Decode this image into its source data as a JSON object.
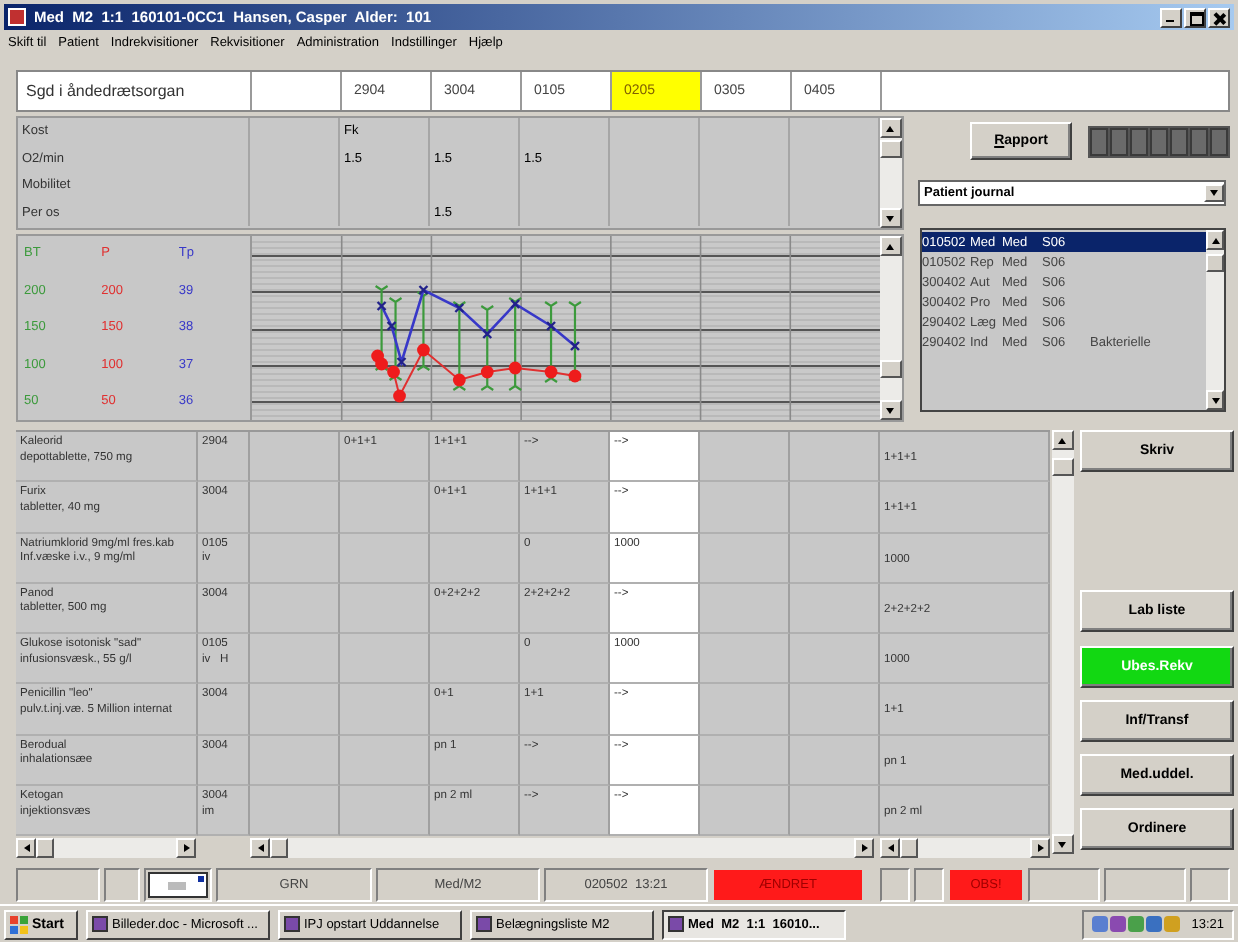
{
  "window": {
    "title": "Med  M2  1:1  160101-0CC1  Hansen, Casper  Alder:  101"
  },
  "menu": [
    "Skift til",
    "Patient",
    "Indrekvisitioner",
    "Rekvisitioner",
    "Administration",
    "Indstillinger",
    "Hjælp"
  ],
  "header": {
    "label": "Sgd i åndedrætsorgan",
    "dates": [
      {
        "label": "2904",
        "selected": false
      },
      {
        "label": "3004",
        "selected": false
      },
      {
        "label": "0105",
        "selected": false
      },
      {
        "label": "0205",
        "selected": true
      },
      {
        "label": "0305",
        "selected": false
      },
      {
        "label": "0405",
        "selected": false
      }
    ]
  },
  "observations": [
    {
      "label": "Kost",
      "values": [
        {
          "kind": "blank"
        },
        {
          "kind": "value",
          "text": "Fk"
        },
        {
          "kind": "blank"
        },
        {
          "kind": "blank"
        },
        {
          "kind": "blank"
        },
        {
          "kind": "blank"
        },
        {
          "kind": "blank"
        }
      ]
    },
    {
      "label": "O2/min",
      "values": [
        {
          "kind": "blank"
        },
        {
          "kind": "value",
          "text": "1.5"
        },
        {
          "kind": "value",
          "text": "1.5"
        },
        {
          "kind": "value",
          "text": "1.5"
        },
        {
          "kind": "blank"
        },
        {
          "kind": "blank"
        },
        {
          "kind": "blank"
        }
      ]
    },
    {
      "label": "Mobilitet",
      "values": [
        {
          "kind": "blank"
        },
        {
          "kind": "blank"
        },
        {
          "kind": "blank"
        },
        {
          "kind": "blank"
        },
        {
          "kind": "blank"
        },
        {
          "kind": "blank"
        },
        {
          "kind": "blank"
        }
      ]
    },
    {
      "label": "Per os",
      "values": [
        {
          "kind": "blank"
        },
        {
          "kind": "blank"
        },
        {
          "kind": "value",
          "text": "1.5"
        },
        {
          "kind": "blank"
        },
        {
          "kind": "blank"
        },
        {
          "kind": "blank"
        },
        {
          "kind": "blank"
        }
      ]
    }
  ],
  "vitals_scales": [
    {
      "name": "BT",
      "color": "#3c9a3c",
      "labels": [
        "200",
        "150",
        "100",
        "50"
      ]
    },
    {
      "name": "P",
      "color": "#e03030",
      "labels": [
        "200",
        "150",
        "100",
        "50"
      ]
    },
    {
      "name": "Tp",
      "color": "#3838c8",
      "labels": [
        "39",
        "38",
        "37",
        "36"
      ]
    }
  ],
  "report_button": "Rapport",
  "journal_dropdown": {
    "value": "Patient journal"
  },
  "journal_list": [
    {
      "cells": [
        "010502",
        "Med",
        "Med",
        "S06"
      ],
      "selected": true
    },
    {
      "cells": [
        "010502",
        "Rep",
        "Med",
        "S06"
      ],
      "selected": false
    },
    {
      "cells": [
        "300402",
        "Aut",
        "Med",
        "S06"
      ],
      "selected": false
    },
    {
      "cells": [
        "300402",
        "Pro",
        "Med",
        "S06"
      ],
      "selected": false
    },
    {
      "cells": [
        "290402",
        "Læg",
        "Med",
        "S06"
      ],
      "selected": false
    },
    {
      "cells": [
        "290402",
        "Ind",
        "Med",
        "S06",
        "Bakterielle"
      ],
      "selected": false
    }
  ],
  "medications": [
    {
      "name": "Kaleorid",
      "form": "depottablette, 750 mg",
      "date": "2904",
      "cells": [
        {
          "kind": "blank"
        },
        {
          "kind": "value",
          "text": "0+1+1"
        },
        {
          "kind": "value",
          "text": "1+1+1"
        },
        {
          "kind": "value",
          "text": "-->"
        },
        {
          "kind": "value",
          "text": "-->"
        },
        {
          "kind": "blank"
        },
        {
          "kind": "blank"
        }
      ],
      "current": "1+1+1"
    },
    {
      "name": "Furix",
      "form": "tabletter, 40 mg",
      "date": "3004",
      "cells": [
        {
          "kind": "blank"
        },
        {
          "kind": "blank"
        },
        {
          "kind": "value",
          "text": "0+1+1"
        },
        {
          "kind": "value",
          "text": "1+1+1"
        },
        {
          "kind": "value",
          "text": "-->"
        },
        {
          "kind": "blank"
        },
        {
          "kind": "blank"
        }
      ],
      "current": "1+1+1"
    },
    {
      "name": "Natriumklorid 9mg/ml fres.kab",
      "form": "Inf.væske i.v., 9 mg/ml",
      "date": "0105",
      "route": "iv",
      "cells": [
        {
          "kind": "blank"
        },
        {
          "kind": "blank"
        },
        {
          "kind": "blank"
        },
        {
          "kind": "value",
          "text": "0"
        },
        {
          "kind": "value",
          "text": "1000"
        },
        {
          "kind": "blank"
        },
        {
          "kind": "blank"
        }
      ],
      "current": "1000"
    },
    {
      "name": "Panod",
      "form": "tabletter, 500 mg",
      "date": "3004",
      "cells": [
        {
          "kind": "blank"
        },
        {
          "kind": "blank"
        },
        {
          "kind": "value",
          "text": "0+2+2+2"
        },
        {
          "kind": "value",
          "text": "2+2+2+2"
        },
        {
          "kind": "value",
          "text": "-->"
        },
        {
          "kind": "blank"
        },
        {
          "kind": "blank"
        }
      ],
      "current": "2+2+2+2"
    },
    {
      "name": "Glukose isotonisk \"sad\"",
      "form": "infusionsvæsk., 55 g/l",
      "date": "0105",
      "route": "iv   H",
      "cells": [
        {
          "kind": "blank"
        },
        {
          "kind": "blank"
        },
        {
          "kind": "blank"
        },
        {
          "kind": "value",
          "text": "0"
        },
        {
          "kind": "value",
          "text": "1000"
        },
        {
          "kind": "blank"
        },
        {
          "kind": "blank"
        }
      ],
      "current": "1000"
    },
    {
      "name": "Penicillin \"leo\"",
      "form": "pulv.t.inj.væ. 5 Million internat",
      "date": "3004",
      "cells": [
        {
          "kind": "blank"
        },
        {
          "kind": "blank"
        },
        {
          "kind": "value",
          "text": "0+1"
        },
        {
          "kind": "value",
          "text": "1+1"
        },
        {
          "kind": "value",
          "text": "-->"
        },
        {
          "kind": "blank"
        },
        {
          "kind": "blank"
        }
      ],
      "current": "1+1"
    },
    {
      "name": "Berodual",
      "form": "inhalationsæe",
      "date": "3004",
      "cells": [
        {
          "kind": "blank"
        },
        {
          "kind": "blank"
        },
        {
          "kind": "value",
          "text": "pn 1"
        },
        {
          "kind": "value",
          "text": "-->"
        },
        {
          "kind": "value",
          "text": "-->"
        },
        {
          "kind": "blank"
        },
        {
          "kind": "blank"
        }
      ],
      "current": "pn 1"
    },
    {
      "name": "Ketogan",
      "form": "injektionsvæs",
      "date": "3004",
      "route": "im",
      "cells": [
        {
          "kind": "blank"
        },
        {
          "kind": "blank"
        },
        {
          "kind": "value",
          "text": "pn 2 ml"
        },
        {
          "kind": "value",
          "text": "-->"
        },
        {
          "kind": "value",
          "text": "-->"
        },
        {
          "kind": "blank"
        },
        {
          "kind": "blank"
        }
      ],
      "current": "pn 2 ml"
    }
  ],
  "actions": [
    {
      "label": "Skriv",
      "highlighted": false
    },
    {
      "label": "Lab liste",
      "highlighted": false
    },
    {
      "label": "Ubes.Rekv",
      "highlighted": true
    },
    {
      "label": "Inf/Transf",
      "highlighted": false
    },
    {
      "label": "Med.uddel.",
      "highlighted": false
    },
    {
      "label": "Ordinere",
      "highlighted": false
    }
  ],
  "status_bar": [
    {
      "kind": "blank"
    },
    {
      "kind": "blank"
    },
    {
      "kind": "icon"
    },
    {
      "kind": "text",
      "text": "GRN"
    },
    {
      "kind": "text",
      "text": "Med/M2"
    },
    {
      "kind": "text",
      "text": "020502  13:21"
    },
    {
      "kind": "alert",
      "text": "ÆNDRET"
    },
    {
      "kind": "blank"
    },
    {
      "kind": "blank"
    },
    {
      "kind": "alert",
      "text": "OBS!"
    },
    {
      "kind": "blank"
    },
    {
      "kind": "blank"
    },
    {
      "kind": "blank"
    }
  ],
  "taskbar": {
    "start": "Start",
    "tasks": [
      {
        "label": "Billeder.doc - Microsoft ...",
        "selected": false
      },
      {
        "label": "IPJ opstart Uddannelse",
        "selected": false
      },
      {
        "label": "Belægningsliste M2",
        "selected": false
      },
      {
        "label": "Med  M2  1:1  16010...",
        "selected": true
      }
    ],
    "clock": "13:21"
  }
}
